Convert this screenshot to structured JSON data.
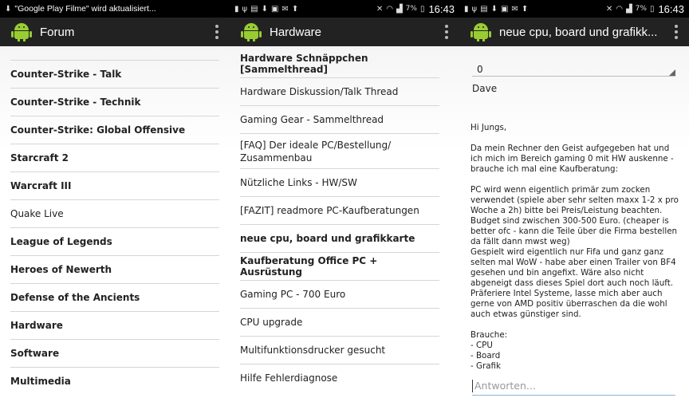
{
  "status": {
    "notification": "\"Google Play Filme\" wird aktualisiert...",
    "battery": "7%",
    "time": "16:43"
  },
  "forum": {
    "title": "Forum",
    "items": [
      "Counter-Strike - Talk",
      "Counter-Strike - Technik",
      "Counter-Strike: Global Offensive",
      "Starcraft 2",
      "Warcraft III",
      "Quake Live",
      "League of Legends",
      "Heroes of Newerth",
      "Defense of the Ancients",
      "Hardware",
      "Software",
      "Multimedia"
    ]
  },
  "hardware": {
    "title": "Hardware",
    "items": [
      "Hardware Schnäppchen [Sammelthread]",
      "Hardware Diskussion/Talk Thread",
      "Gaming Gear - Sammelthread",
      "[FAQ] Der ideale PC/Bestellung/\nZusammenbau",
      "Nützliche Links - HW/SW",
      "[FAZIT] readmore PC-Kaufberatungen",
      "neue cpu, board und grafikkarte",
      "Kaufberatung Office PC + Ausrüstung",
      "Gaming PC - 700 Euro",
      "CPU upgrade",
      "Multifunktionsdrucker gesucht",
      "Hilfe Fehlerdiagnose"
    ]
  },
  "thread": {
    "title": "neue cpu, board und grafikk...",
    "page_value": "0",
    "author": "Dave",
    "post": "Hi Jungs,\n\nDa mein Rechner den Geist aufgegeben hat und ich mich im Bereich gaming 0 mit HW auskenne - brauche ich mal eine Kaufberatung:\n\nPC wird wenn eigentlich primär zum zocken verwendet (spiele aber sehr selten maxx 1-2 x pro Woche a 2h) bitte bei Preis/Leistung beachten.\nBudget sind zwischen 300-500 Euro. (cheaper is better ofc - kann die Teile über die Firma bestellen da fällt dann mwst weg)\nGespielt wird eigentlich nur Fifa und ganz ganz selten mal WoW - habe aber einen Trailer von BF4 gesehen und bin angefixt. Wäre also nicht abgeneigt dass dieses Spiel dort auch noch läuft.\nPräferiere Intel Systeme, lasse mich aber auch gerne von AMD positiv überraschen da die wohl auch etwas günstiger sind.\n\nBrauche:\n- CPU\n- Board\n- Grafik",
    "reply_placeholder": "Antworten..."
  }
}
